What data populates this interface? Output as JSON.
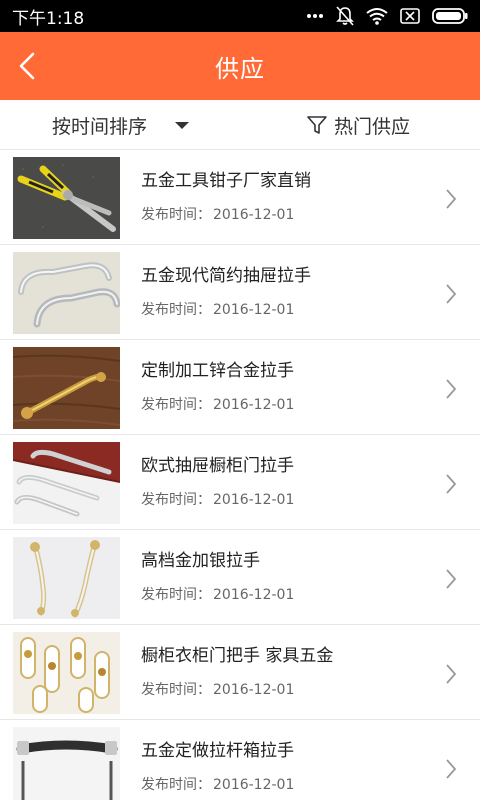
{
  "status_bar": {
    "time": "下午1:18"
  },
  "header": {
    "title": "供应"
  },
  "filters": {
    "sort_label": "按时间排序",
    "hot_label": "热门供应"
  },
  "date_label": "发布时间：",
  "items": [
    {
      "title": "五金工具钳子厂家直销",
      "date": "2016-12-01",
      "image": "pliers"
    },
    {
      "title": "五金现代简约抽屉拉手",
      "date": "2016-12-01",
      "image": "silver-handles"
    },
    {
      "title": "定制加工锌合金拉手",
      "date": "2016-12-01",
      "image": "gold-handle-on-wood"
    },
    {
      "title": "欧式抽屉橱柜门拉手",
      "date": "2016-12-01",
      "image": "silver-handles-red-wood"
    },
    {
      "title": "高档金加银拉手",
      "date": "2016-12-01",
      "image": "ornate-gold-silver-handles"
    },
    {
      "title": "橱柜衣柜门把手 家具五金",
      "date": "2016-12-01",
      "image": "floral-ceramic-knobs"
    },
    {
      "title": "五金定做拉杆箱拉手",
      "date": "2016-12-01",
      "image": "luggage-handle"
    }
  ]
}
